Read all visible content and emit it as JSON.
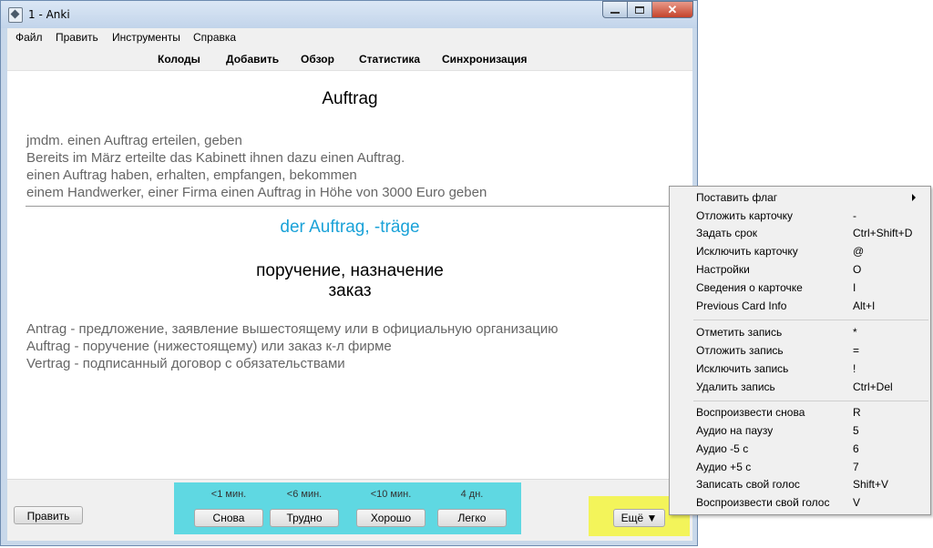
{
  "window": {
    "title": "1 - Anki",
    "close_symbol": "✕"
  },
  "menubar": [
    "Файл",
    "Править",
    "Инструменты",
    "Справка"
  ],
  "toolbar": [
    "Колоды",
    "Добавить",
    "Обзор",
    "Статистика",
    "Синхронизация"
  ],
  "card": {
    "front_word": "Auftrag",
    "examples": [
      "jmdm. einen Auftrag erteilen, geben",
      "Bereits im März erteilte das Kabinett ihnen dazu einen Auftrag.",
      "einen Auftrag haben, erhalten, empfangen, bekommen",
      "einem Handwerker, einer Firma einen Auftrag in Höhe von 3000 Euro geben"
    ],
    "back_word": "der Auftrag, -träge",
    "translation": [
      "поручение, назначение",
      "заказ"
    ],
    "notes": [
      "Antrag - предложение, заявление вышестоящему или в официальную организацию",
      "Auftrag - поручение (нижестоящему) или заказ к-л фирме",
      "Vertrag - подписанный договор с обязательствами"
    ]
  },
  "bottom": {
    "edit_label": "Править",
    "answers": [
      {
        "time": "<1 мин.",
        "label": "Снова"
      },
      {
        "time": "<6 мин.",
        "label": "Трудно"
      },
      {
        "time": "<10 мин.",
        "label": "Хорошо"
      },
      {
        "time": "4 дн.",
        "label": "Легко"
      }
    ],
    "more_label": "Ещё ▼"
  },
  "context_menu": [
    {
      "label": "Поставить флаг",
      "shortcut": "",
      "submenu": true
    },
    {
      "label": "Отложить карточку",
      "shortcut": "-"
    },
    {
      "label": "Задать срок",
      "shortcut": "Ctrl+Shift+D"
    },
    {
      "label": "Исключить карточку",
      "shortcut": "@"
    },
    {
      "label": "Настройки",
      "shortcut": "O"
    },
    {
      "label": "Сведения о карточке",
      "shortcut": "I"
    },
    {
      "label": "Previous Card Info",
      "shortcut": "Alt+I"
    },
    {
      "label": "Отметить запись",
      "shortcut": "*"
    },
    {
      "label": "Отложить запись",
      "shortcut": "="
    },
    {
      "label": "Исключить запись",
      "shortcut": "!"
    },
    {
      "label": "Удалить запись",
      "shortcut": "Ctrl+Del"
    },
    {
      "label": "Воспроизвести снова",
      "shortcut": "R"
    },
    {
      "label": "Аудио на паузу",
      "shortcut": "5"
    },
    {
      "label": "Аудио -5 с",
      "shortcut": "6"
    },
    {
      "label": "Аудио +5 с",
      "shortcut": "7"
    },
    {
      "label": "Записать свой голос",
      "shortcut": "Shift+V"
    },
    {
      "label": "Воспроизвести свой голос",
      "shortcut": "V"
    }
  ],
  "colors": {
    "back_word": "#1aa2d8",
    "answer_highlight": "#5fd8e2",
    "more_highlight": "#f3f45a"
  }
}
